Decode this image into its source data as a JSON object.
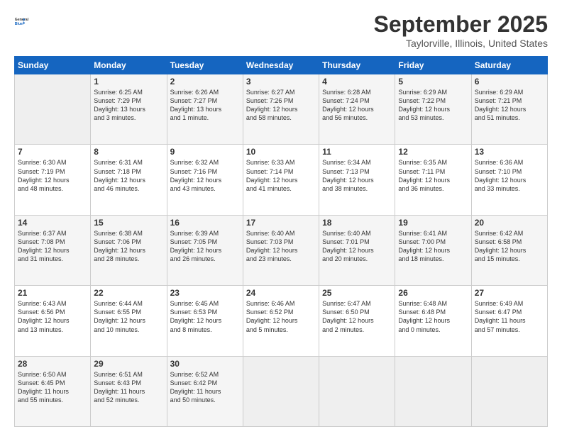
{
  "logo": {
    "line1": "General",
    "line2": "Blue"
  },
  "title": "September 2025",
  "location": "Taylorville, Illinois, United States",
  "days_header": [
    "Sunday",
    "Monday",
    "Tuesday",
    "Wednesday",
    "Thursday",
    "Friday",
    "Saturday"
  ],
  "weeks": [
    [
      {
        "num": "",
        "info": ""
      },
      {
        "num": "1",
        "info": "Sunrise: 6:25 AM\nSunset: 7:29 PM\nDaylight: 13 hours\nand 3 minutes."
      },
      {
        "num": "2",
        "info": "Sunrise: 6:26 AM\nSunset: 7:27 PM\nDaylight: 13 hours\nand 1 minute."
      },
      {
        "num": "3",
        "info": "Sunrise: 6:27 AM\nSunset: 7:26 PM\nDaylight: 12 hours\nand 58 minutes."
      },
      {
        "num": "4",
        "info": "Sunrise: 6:28 AM\nSunset: 7:24 PM\nDaylight: 12 hours\nand 56 minutes."
      },
      {
        "num": "5",
        "info": "Sunrise: 6:29 AM\nSunset: 7:22 PM\nDaylight: 12 hours\nand 53 minutes."
      },
      {
        "num": "6",
        "info": "Sunrise: 6:29 AM\nSunset: 7:21 PM\nDaylight: 12 hours\nand 51 minutes."
      }
    ],
    [
      {
        "num": "7",
        "info": "Sunrise: 6:30 AM\nSunset: 7:19 PM\nDaylight: 12 hours\nand 48 minutes."
      },
      {
        "num": "8",
        "info": "Sunrise: 6:31 AM\nSunset: 7:18 PM\nDaylight: 12 hours\nand 46 minutes."
      },
      {
        "num": "9",
        "info": "Sunrise: 6:32 AM\nSunset: 7:16 PM\nDaylight: 12 hours\nand 43 minutes."
      },
      {
        "num": "10",
        "info": "Sunrise: 6:33 AM\nSunset: 7:14 PM\nDaylight: 12 hours\nand 41 minutes."
      },
      {
        "num": "11",
        "info": "Sunrise: 6:34 AM\nSunset: 7:13 PM\nDaylight: 12 hours\nand 38 minutes."
      },
      {
        "num": "12",
        "info": "Sunrise: 6:35 AM\nSunset: 7:11 PM\nDaylight: 12 hours\nand 36 minutes."
      },
      {
        "num": "13",
        "info": "Sunrise: 6:36 AM\nSunset: 7:10 PM\nDaylight: 12 hours\nand 33 minutes."
      }
    ],
    [
      {
        "num": "14",
        "info": "Sunrise: 6:37 AM\nSunset: 7:08 PM\nDaylight: 12 hours\nand 31 minutes."
      },
      {
        "num": "15",
        "info": "Sunrise: 6:38 AM\nSunset: 7:06 PM\nDaylight: 12 hours\nand 28 minutes."
      },
      {
        "num": "16",
        "info": "Sunrise: 6:39 AM\nSunset: 7:05 PM\nDaylight: 12 hours\nand 26 minutes."
      },
      {
        "num": "17",
        "info": "Sunrise: 6:40 AM\nSunset: 7:03 PM\nDaylight: 12 hours\nand 23 minutes."
      },
      {
        "num": "18",
        "info": "Sunrise: 6:40 AM\nSunset: 7:01 PM\nDaylight: 12 hours\nand 20 minutes."
      },
      {
        "num": "19",
        "info": "Sunrise: 6:41 AM\nSunset: 7:00 PM\nDaylight: 12 hours\nand 18 minutes."
      },
      {
        "num": "20",
        "info": "Sunrise: 6:42 AM\nSunset: 6:58 PM\nDaylight: 12 hours\nand 15 minutes."
      }
    ],
    [
      {
        "num": "21",
        "info": "Sunrise: 6:43 AM\nSunset: 6:56 PM\nDaylight: 12 hours\nand 13 minutes."
      },
      {
        "num": "22",
        "info": "Sunrise: 6:44 AM\nSunset: 6:55 PM\nDaylight: 12 hours\nand 10 minutes."
      },
      {
        "num": "23",
        "info": "Sunrise: 6:45 AM\nSunset: 6:53 PM\nDaylight: 12 hours\nand 8 minutes."
      },
      {
        "num": "24",
        "info": "Sunrise: 6:46 AM\nSunset: 6:52 PM\nDaylight: 12 hours\nand 5 minutes."
      },
      {
        "num": "25",
        "info": "Sunrise: 6:47 AM\nSunset: 6:50 PM\nDaylight: 12 hours\nand 2 minutes."
      },
      {
        "num": "26",
        "info": "Sunrise: 6:48 AM\nSunset: 6:48 PM\nDaylight: 12 hours\nand 0 minutes."
      },
      {
        "num": "27",
        "info": "Sunrise: 6:49 AM\nSunset: 6:47 PM\nDaylight: 11 hours\nand 57 minutes."
      }
    ],
    [
      {
        "num": "28",
        "info": "Sunrise: 6:50 AM\nSunset: 6:45 PM\nDaylight: 11 hours\nand 55 minutes."
      },
      {
        "num": "29",
        "info": "Sunrise: 6:51 AM\nSunset: 6:43 PM\nDaylight: 11 hours\nand 52 minutes."
      },
      {
        "num": "30",
        "info": "Sunrise: 6:52 AM\nSunset: 6:42 PM\nDaylight: 11 hours\nand 50 minutes."
      },
      {
        "num": "",
        "info": ""
      },
      {
        "num": "",
        "info": ""
      },
      {
        "num": "",
        "info": ""
      },
      {
        "num": "",
        "info": ""
      }
    ]
  ]
}
